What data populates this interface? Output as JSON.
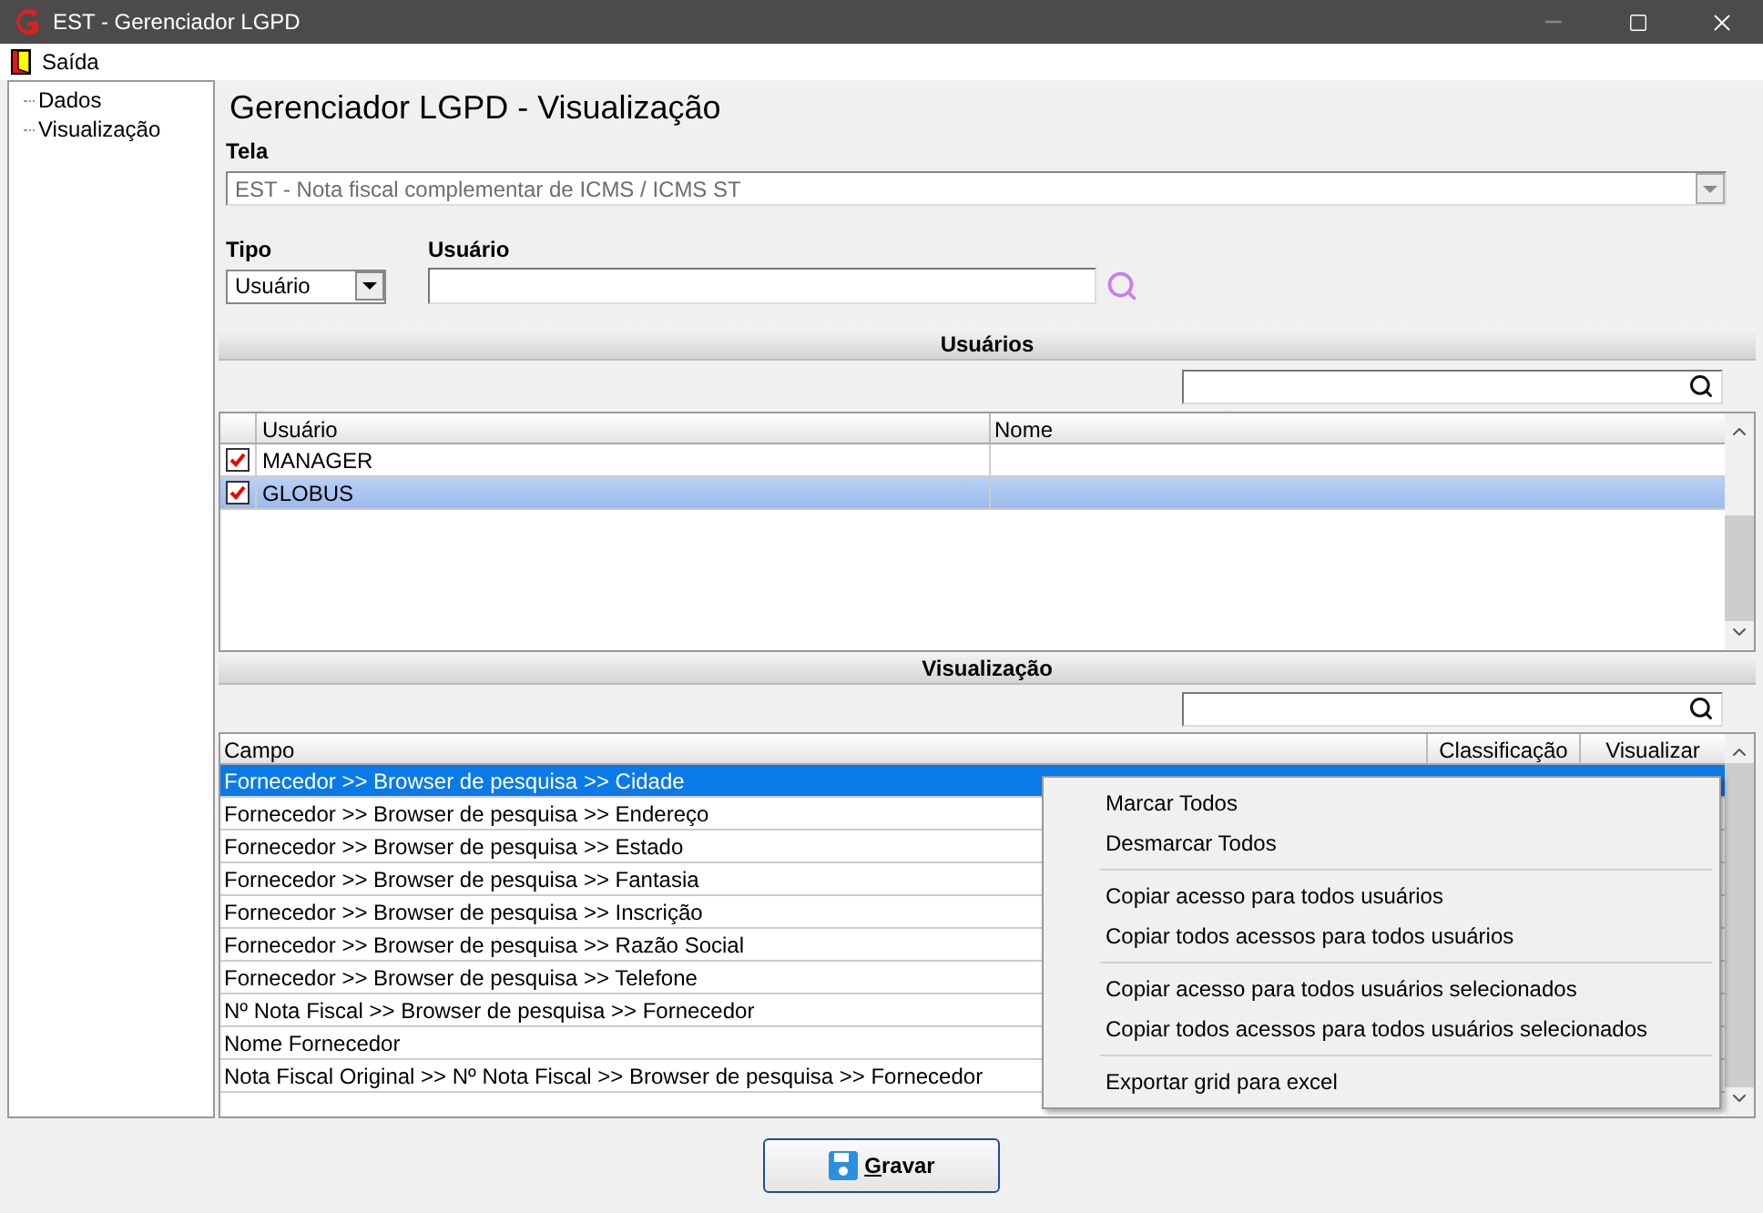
{
  "window": {
    "title": "EST - Gerenciador LGPD"
  },
  "menu": [
    {
      "label": "Saída"
    }
  ],
  "tree": [
    {
      "label": "Dados"
    },
    {
      "label": "Visualização"
    }
  ],
  "heading": "Gerenciador LGPD - Visualização",
  "tela": {
    "label": "Tela",
    "value": "EST - Nota fiscal complementar de ICMS / ICMS ST",
    "disabled": true
  },
  "tipo": {
    "label": "Tipo",
    "value": "Usuário"
  },
  "usuario": {
    "label": "Usuário"
  },
  "users_section": {
    "title": "Usuários",
    "columns": [
      "Usuário",
      "Nome"
    ],
    "rows": [
      {
        "checked": true,
        "selected": false,
        "usuario": "MANAGER"
      },
      {
        "checked": true,
        "selected": true,
        "usuario": "GLOBUS"
      }
    ]
  },
  "view_section": {
    "title": "Visualização",
    "columns": [
      "Campo",
      "Classificação",
      "Visualizar"
    ],
    "rows": [
      {
        "campo": "Fornecedor >> Browser de pesquisa >> Cidade",
        "selected": true
      },
      {
        "campo": "Fornecedor >> Browser de pesquisa >> Endereço",
        "selected": false
      },
      {
        "campo": "Fornecedor >> Browser de pesquisa >> Estado",
        "selected": false
      },
      {
        "campo": "Fornecedor >> Browser de pesquisa >> Fantasia",
        "selected": false
      },
      {
        "campo": "Fornecedor >> Browser de pesquisa >> Inscrição",
        "selected": false
      },
      {
        "campo": "Fornecedor >> Browser de pesquisa >> Razão Social",
        "selected": false
      },
      {
        "campo": "Fornecedor >> Browser de pesquisa >> Telefone",
        "selected": false
      },
      {
        "campo": "Nº Nota Fiscal >> Browser de pesquisa >> Fornecedor",
        "selected": false
      },
      {
        "campo": "Nome Fornecedor",
        "selected": false
      },
      {
        "campo": "Nota Fiscal Original >> Nº Nota Fiscal >> Browser de pesquisa >> Fornecedor",
        "selected": false
      }
    ]
  },
  "context_menu": {
    "groups": [
      [
        "Marcar Todos",
        "Desmarcar Todos"
      ],
      [
        "Copiar acesso para todos usuários",
        "Copiar todos acessos para todos usuários"
      ],
      [
        "Copiar acesso para todos usuários selecionados",
        "Copiar todos acessos para todos usuários selecionados"
      ],
      [
        "Exportar grid para excel"
      ]
    ]
  },
  "save_button": {
    "label": "Gravar",
    "mnemonic": true
  }
}
